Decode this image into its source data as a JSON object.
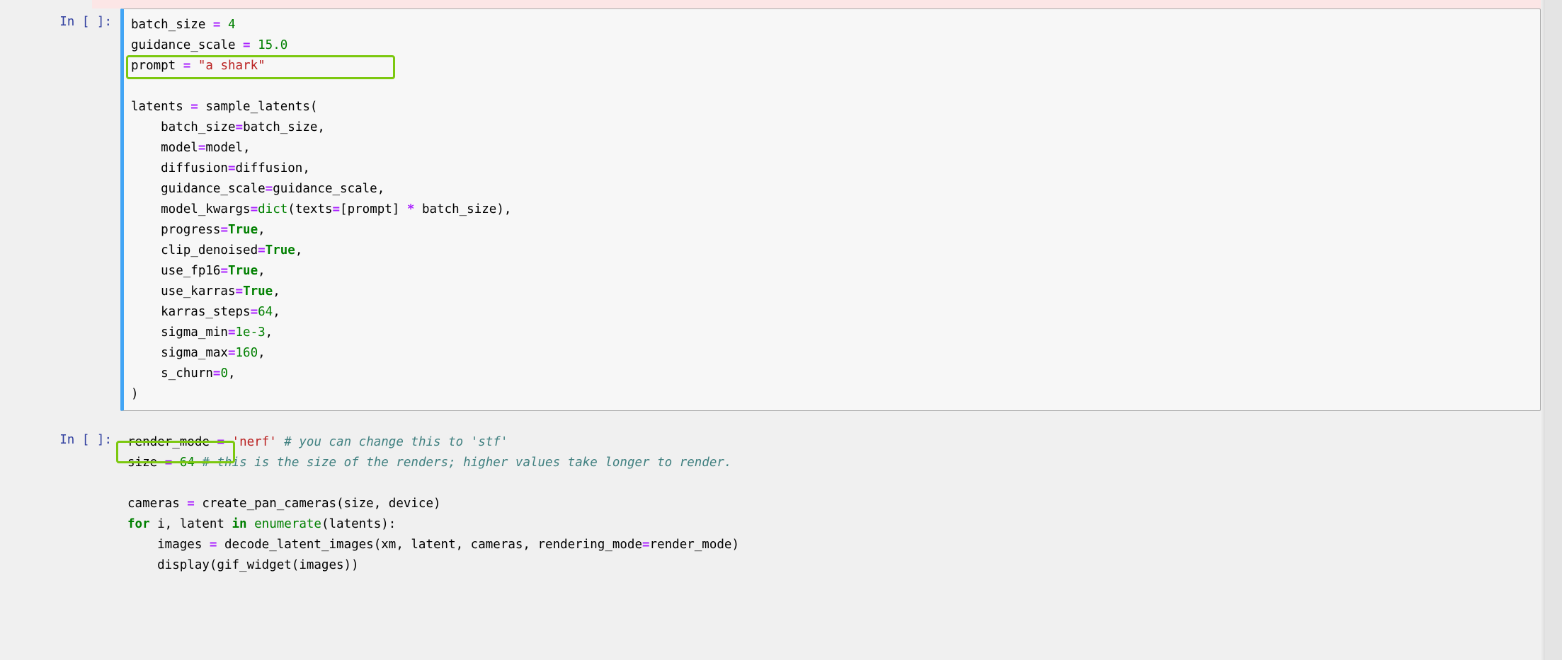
{
  "cell1": {
    "prompt": "In [ ]:",
    "code_tokens": [
      [
        "batch_size ",
        ""
      ],
      [
        "=",
        "op"
      ],
      [
        " ",
        ""
      ],
      [
        "4",
        "num"
      ],
      [
        "\n",
        ""
      ],
      [
        "guidance_scale ",
        ""
      ],
      [
        "=",
        "op"
      ],
      [
        " ",
        ""
      ],
      [
        "15.0",
        "num"
      ],
      [
        "\n",
        ""
      ],
      [
        "prompt ",
        ""
      ],
      [
        "=",
        "op"
      ],
      [
        " ",
        ""
      ],
      [
        "\"a shark\"",
        "str"
      ],
      [
        "\n",
        ""
      ],
      [
        "\n",
        ""
      ],
      [
        "latents ",
        ""
      ],
      [
        "=",
        "op"
      ],
      [
        " sample_latents(\n",
        ""
      ],
      [
        "    batch_size",
        ""
      ],
      [
        "=",
        "op"
      ],
      [
        "batch_size,\n",
        ""
      ],
      [
        "    model",
        ""
      ],
      [
        "=",
        "op"
      ],
      [
        "model,\n",
        ""
      ],
      [
        "    diffusion",
        ""
      ],
      [
        "=",
        "op"
      ],
      [
        "diffusion,\n",
        ""
      ],
      [
        "    guidance_scale",
        ""
      ],
      [
        "=",
        "op"
      ],
      [
        "guidance_scale,\n",
        ""
      ],
      [
        "    model_kwargs",
        ""
      ],
      [
        "=",
        "op"
      ],
      [
        "dict",
        "bi"
      ],
      [
        "(texts",
        ""
      ],
      [
        "=",
        "op"
      ],
      [
        "[prompt] ",
        ""
      ],
      [
        "*",
        "op"
      ],
      [
        " batch_size),\n",
        ""
      ],
      [
        "    progress",
        ""
      ],
      [
        "=",
        "op"
      ],
      [
        "True",
        "bool"
      ],
      [
        ",\n",
        ""
      ],
      [
        "    clip_denoised",
        ""
      ],
      [
        "=",
        "op"
      ],
      [
        "True",
        "bool"
      ],
      [
        ",\n",
        ""
      ],
      [
        "    use_fp16",
        ""
      ],
      [
        "=",
        "op"
      ],
      [
        "True",
        "bool"
      ],
      [
        ",\n",
        ""
      ],
      [
        "    use_karras",
        ""
      ],
      [
        "=",
        "op"
      ],
      [
        "True",
        "bool"
      ],
      [
        ",\n",
        ""
      ],
      [
        "    karras_steps",
        ""
      ],
      [
        "=",
        "op"
      ],
      [
        "64",
        "num"
      ],
      [
        ",\n",
        ""
      ],
      [
        "    sigma_min",
        ""
      ],
      [
        "=",
        "op"
      ],
      [
        "1e-3",
        "num"
      ],
      [
        ",\n",
        ""
      ],
      [
        "    sigma_max",
        ""
      ],
      [
        "=",
        "op"
      ],
      [
        "160",
        "num"
      ],
      [
        ",\n",
        ""
      ],
      [
        "    s_churn",
        ""
      ],
      [
        "=",
        "op"
      ],
      [
        "0",
        "num"
      ],
      [
        ",\n",
        ""
      ],
      [
        ")",
        ""
      ]
    ]
  },
  "cell2": {
    "prompt": "In [ ]:",
    "code_tokens": [
      [
        "render_mode ",
        ""
      ],
      [
        "=",
        "op"
      ],
      [
        " ",
        ""
      ],
      [
        "'nerf'",
        "str"
      ],
      [
        " ",
        ""
      ],
      [
        "# you can change this to 'stf'",
        "cmt"
      ],
      [
        "\n",
        ""
      ],
      [
        "size ",
        ""
      ],
      [
        "=",
        "op"
      ],
      [
        " ",
        ""
      ],
      [
        "64",
        "num"
      ],
      [
        " ",
        ""
      ],
      [
        "# this is the size of the renders; higher values take longer to render.",
        "cmt"
      ],
      [
        "\n",
        ""
      ],
      [
        "\n",
        ""
      ],
      [
        "cameras ",
        ""
      ],
      [
        "=",
        "op"
      ],
      [
        " create_pan_cameras(size, device)\n",
        ""
      ],
      [
        "for",
        "kw"
      ],
      [
        " i, latent ",
        ""
      ],
      [
        "in",
        "kw"
      ],
      [
        " ",
        ""
      ],
      [
        "enumerate",
        "bi"
      ],
      [
        "(latents):\n",
        ""
      ],
      [
        "    images ",
        ""
      ],
      [
        "=",
        "op"
      ],
      [
        " decode_latent_images(xm, latent, cameras, rendering_mode",
        ""
      ],
      [
        "=",
        "op"
      ],
      [
        "render_mode)\n",
        ""
      ],
      [
        "    display(gif_widget(images))",
        ""
      ]
    ]
  },
  "annotations": {
    "highlight1": "prompt = \"a shark\"",
    "highlight2": "size = 64 #"
  }
}
